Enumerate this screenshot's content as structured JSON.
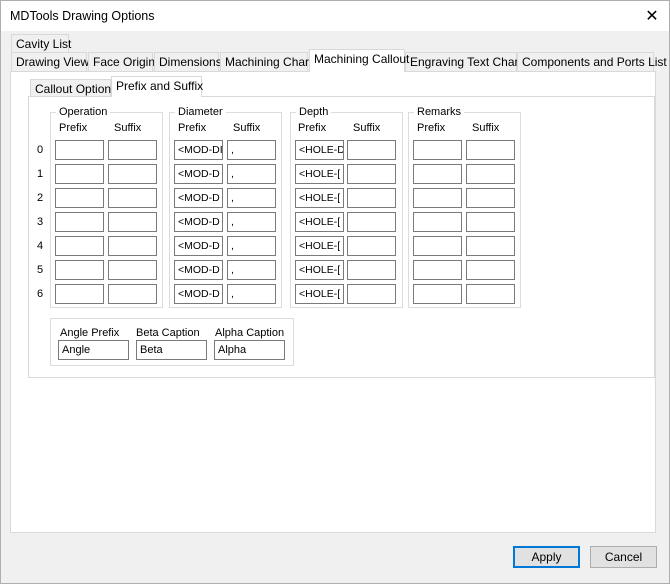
{
  "window": {
    "title": "MDTools Drawing Options",
    "close_glyph": "✕"
  },
  "tabs_row1": [
    "Cavity List"
  ],
  "tabs_row2": [
    "Drawing View",
    "Face Origin",
    "Dimensions",
    "Machining Chart",
    "Machining Callout",
    "Engraving Text Chart",
    "Components and Ports List"
  ],
  "active_tab": "Machining Callout",
  "subtabs": [
    "Callout Options",
    "Prefix and Suffix"
  ],
  "active_subtab": "Prefix and Suffix",
  "row_labels": [
    "0",
    "1",
    "2",
    "3",
    "4",
    "5",
    "6"
  ],
  "groups": [
    {
      "title": "Operation",
      "prefix_label": "Prefix",
      "suffix_label": "Suffix",
      "prefix_values": [
        "",
        "",
        "",
        "",
        "",
        "",
        ""
      ],
      "suffix_values": [
        "",
        "",
        "",
        "",
        "",
        "",
        ""
      ]
    },
    {
      "title": "Diameter",
      "prefix_label": "Prefix",
      "suffix_label": "Suffix",
      "prefix_values": [
        "<MOD-DI",
        "<MOD-D",
        "<MOD-D",
        "<MOD-D",
        "<MOD-D",
        "<MOD-D",
        "<MOD-D"
      ],
      "suffix_values": [
        ",",
        ",",
        ",",
        ",",
        ",",
        ",",
        ","
      ]
    },
    {
      "title": "Depth",
      "prefix_label": "Prefix",
      "suffix_label": "Suffix",
      "prefix_values": [
        "<HOLE-D",
        "<HOLE-[",
        "<HOLE-[",
        "<HOLE-[",
        "<HOLE-[",
        "<HOLE-[",
        "<HOLE-["
      ],
      "suffix_values": [
        "",
        "",
        "",
        "",
        "",
        "",
        ""
      ]
    },
    {
      "title": "Remarks",
      "prefix_label": "Prefix",
      "suffix_label": "Suffix",
      "prefix_values": [
        "",
        "",
        "",
        "",
        "",
        "",
        ""
      ],
      "suffix_values": [
        "",
        "",
        "",
        "",
        "",
        "",
        ""
      ]
    }
  ],
  "angles": {
    "angle_prefix_label": "Angle Prefix",
    "angle_prefix_value": "Angle",
    "beta_caption_label": "Beta Caption",
    "beta_caption_value": "Beta",
    "alpha_caption_label": "Alpha Caption",
    "alpha_caption_value": "Alpha"
  },
  "buttons": {
    "apply": "Apply",
    "cancel": "Cancel"
  }
}
